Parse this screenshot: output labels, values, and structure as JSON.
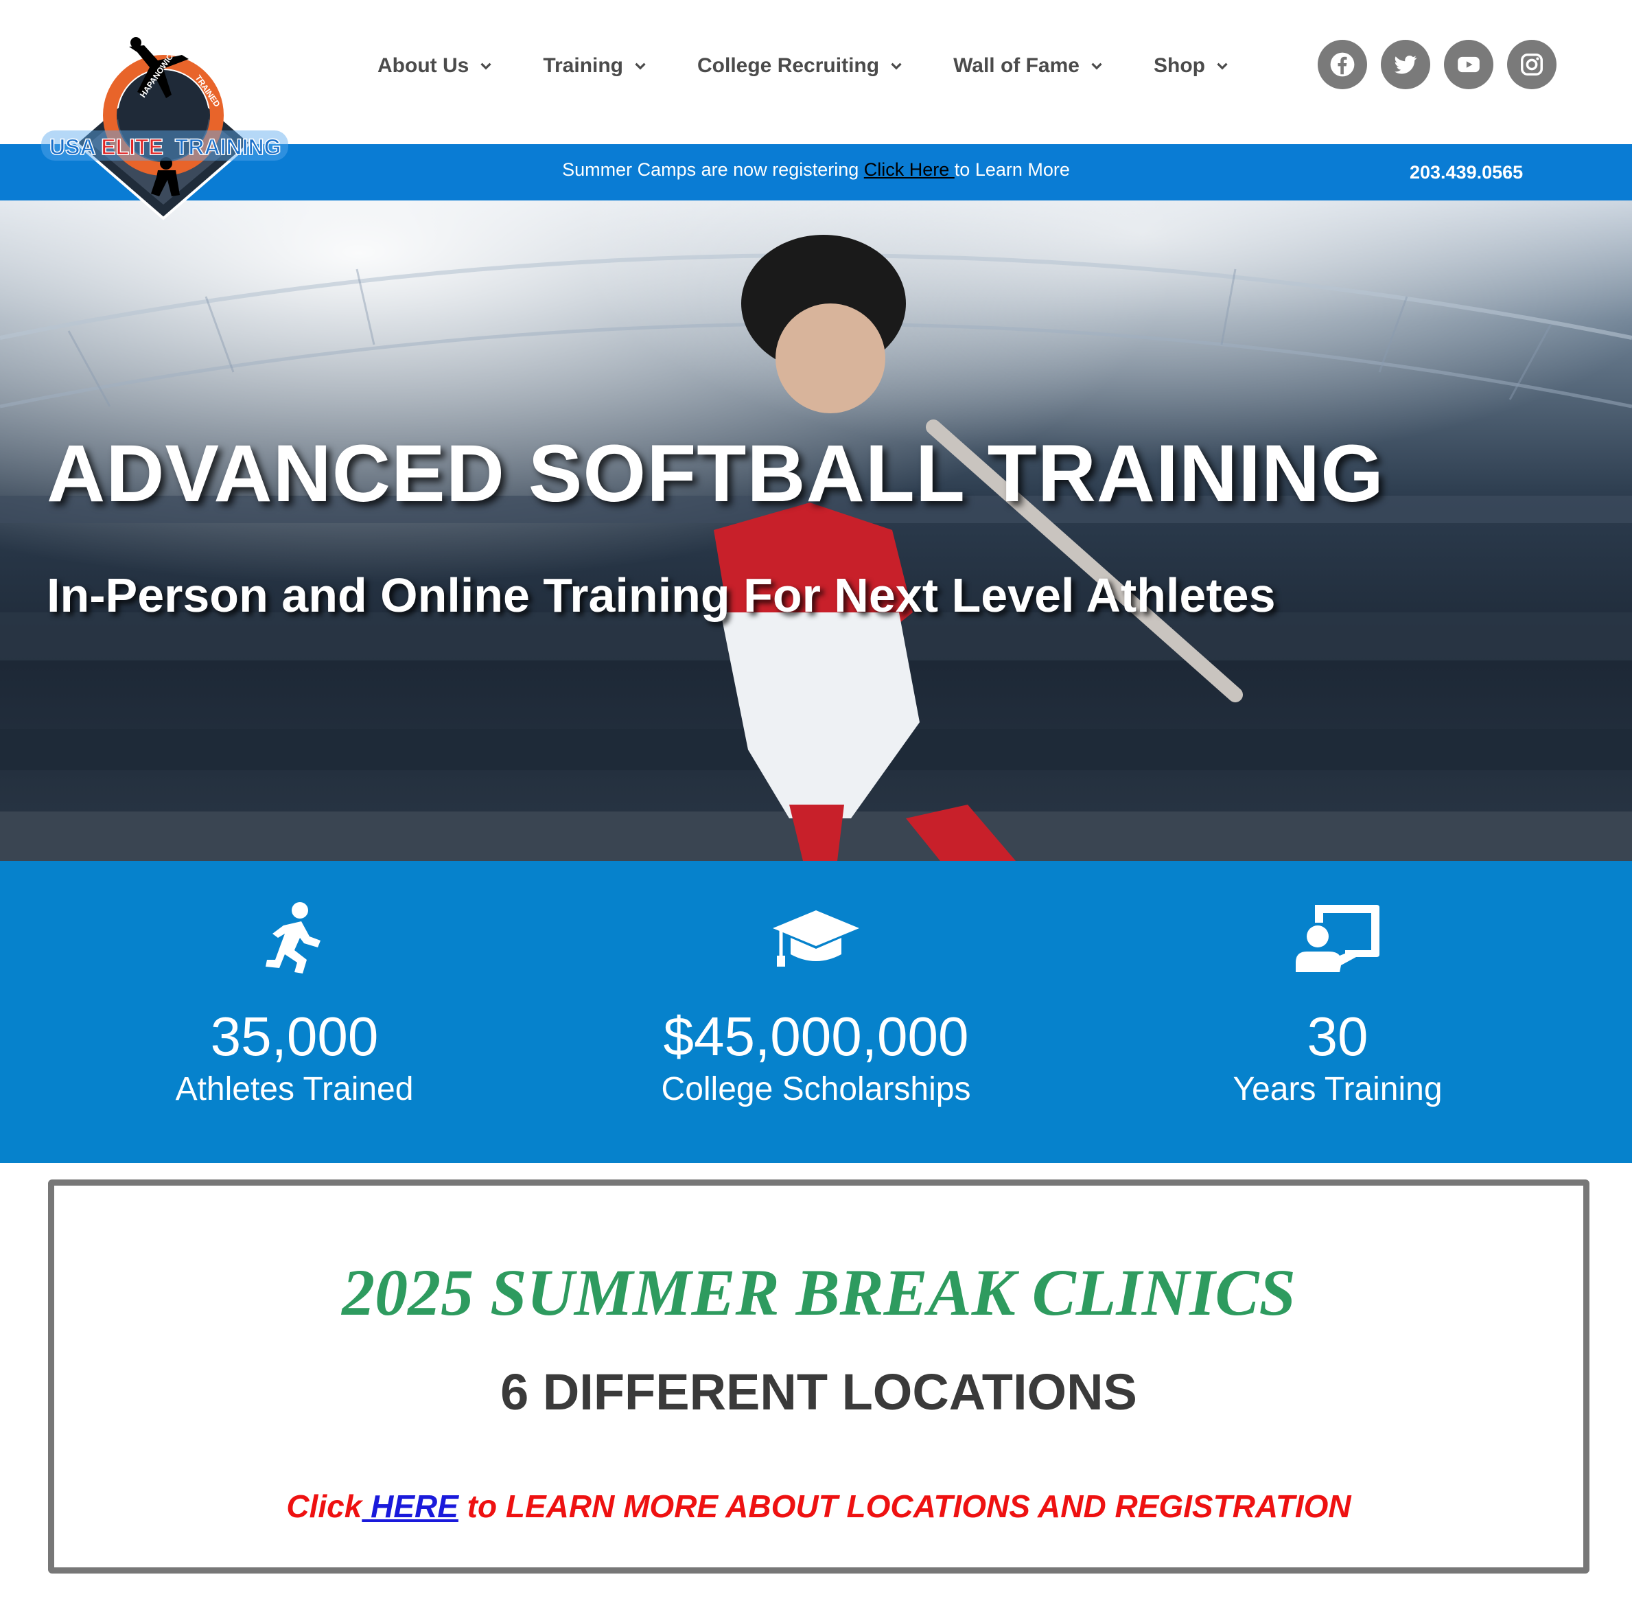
{
  "header": {
    "logo": {
      "wordmark_a": "USA",
      "wordmark_b": "ELITE",
      "wordmark_c": "TRAINING",
      "arc_left": "HAPANOWICZ",
      "arc_right": "TRAINED"
    },
    "nav": [
      {
        "label": "About Us"
      },
      {
        "label": "Training"
      },
      {
        "label": "College Recruiting"
      },
      {
        "label": "Wall of Fame"
      },
      {
        "label": "Shop"
      }
    ],
    "socials": [
      "facebook-icon",
      "twitter-icon",
      "youtube-icon",
      "instagram-icon"
    ]
  },
  "promo": {
    "text_before": "Summer Camps are now registering ",
    "link_text": "Click Here ",
    "text_after": "to Learn More",
    "phone": "203.439.0565"
  },
  "hero": {
    "title": "ADVANCED SOFTBALL TRAINING",
    "subtitle": "In-Person and Online Training For Next Level Athletes"
  },
  "stats": [
    {
      "icon": "running-icon",
      "value": "35,000",
      "label": "Athletes Trained"
    },
    {
      "icon": "graduation-cap-icon",
      "value": "$45,000,000",
      "label": "College Scholarships"
    },
    {
      "icon": "teacher-board-icon",
      "value": "30",
      "label": "Years Training"
    }
  ],
  "clinics": {
    "title": "2025 SUMMER BREAK CLINICS",
    "subtitle": "6 DIFFERENT LOCATIONS",
    "cta_before": "Click",
    "cta_link": " HERE",
    "cta_after": " to LEARN MORE ABOUT LOCATIONS AND REGISTRATION"
  },
  "colors": {
    "brand_blue": "#0a7cd4",
    "stats_blue": "#0682cc",
    "clinic_green": "#2e9b5f",
    "cta_red": "#ee1111",
    "social_gray": "#7a7a7a"
  }
}
